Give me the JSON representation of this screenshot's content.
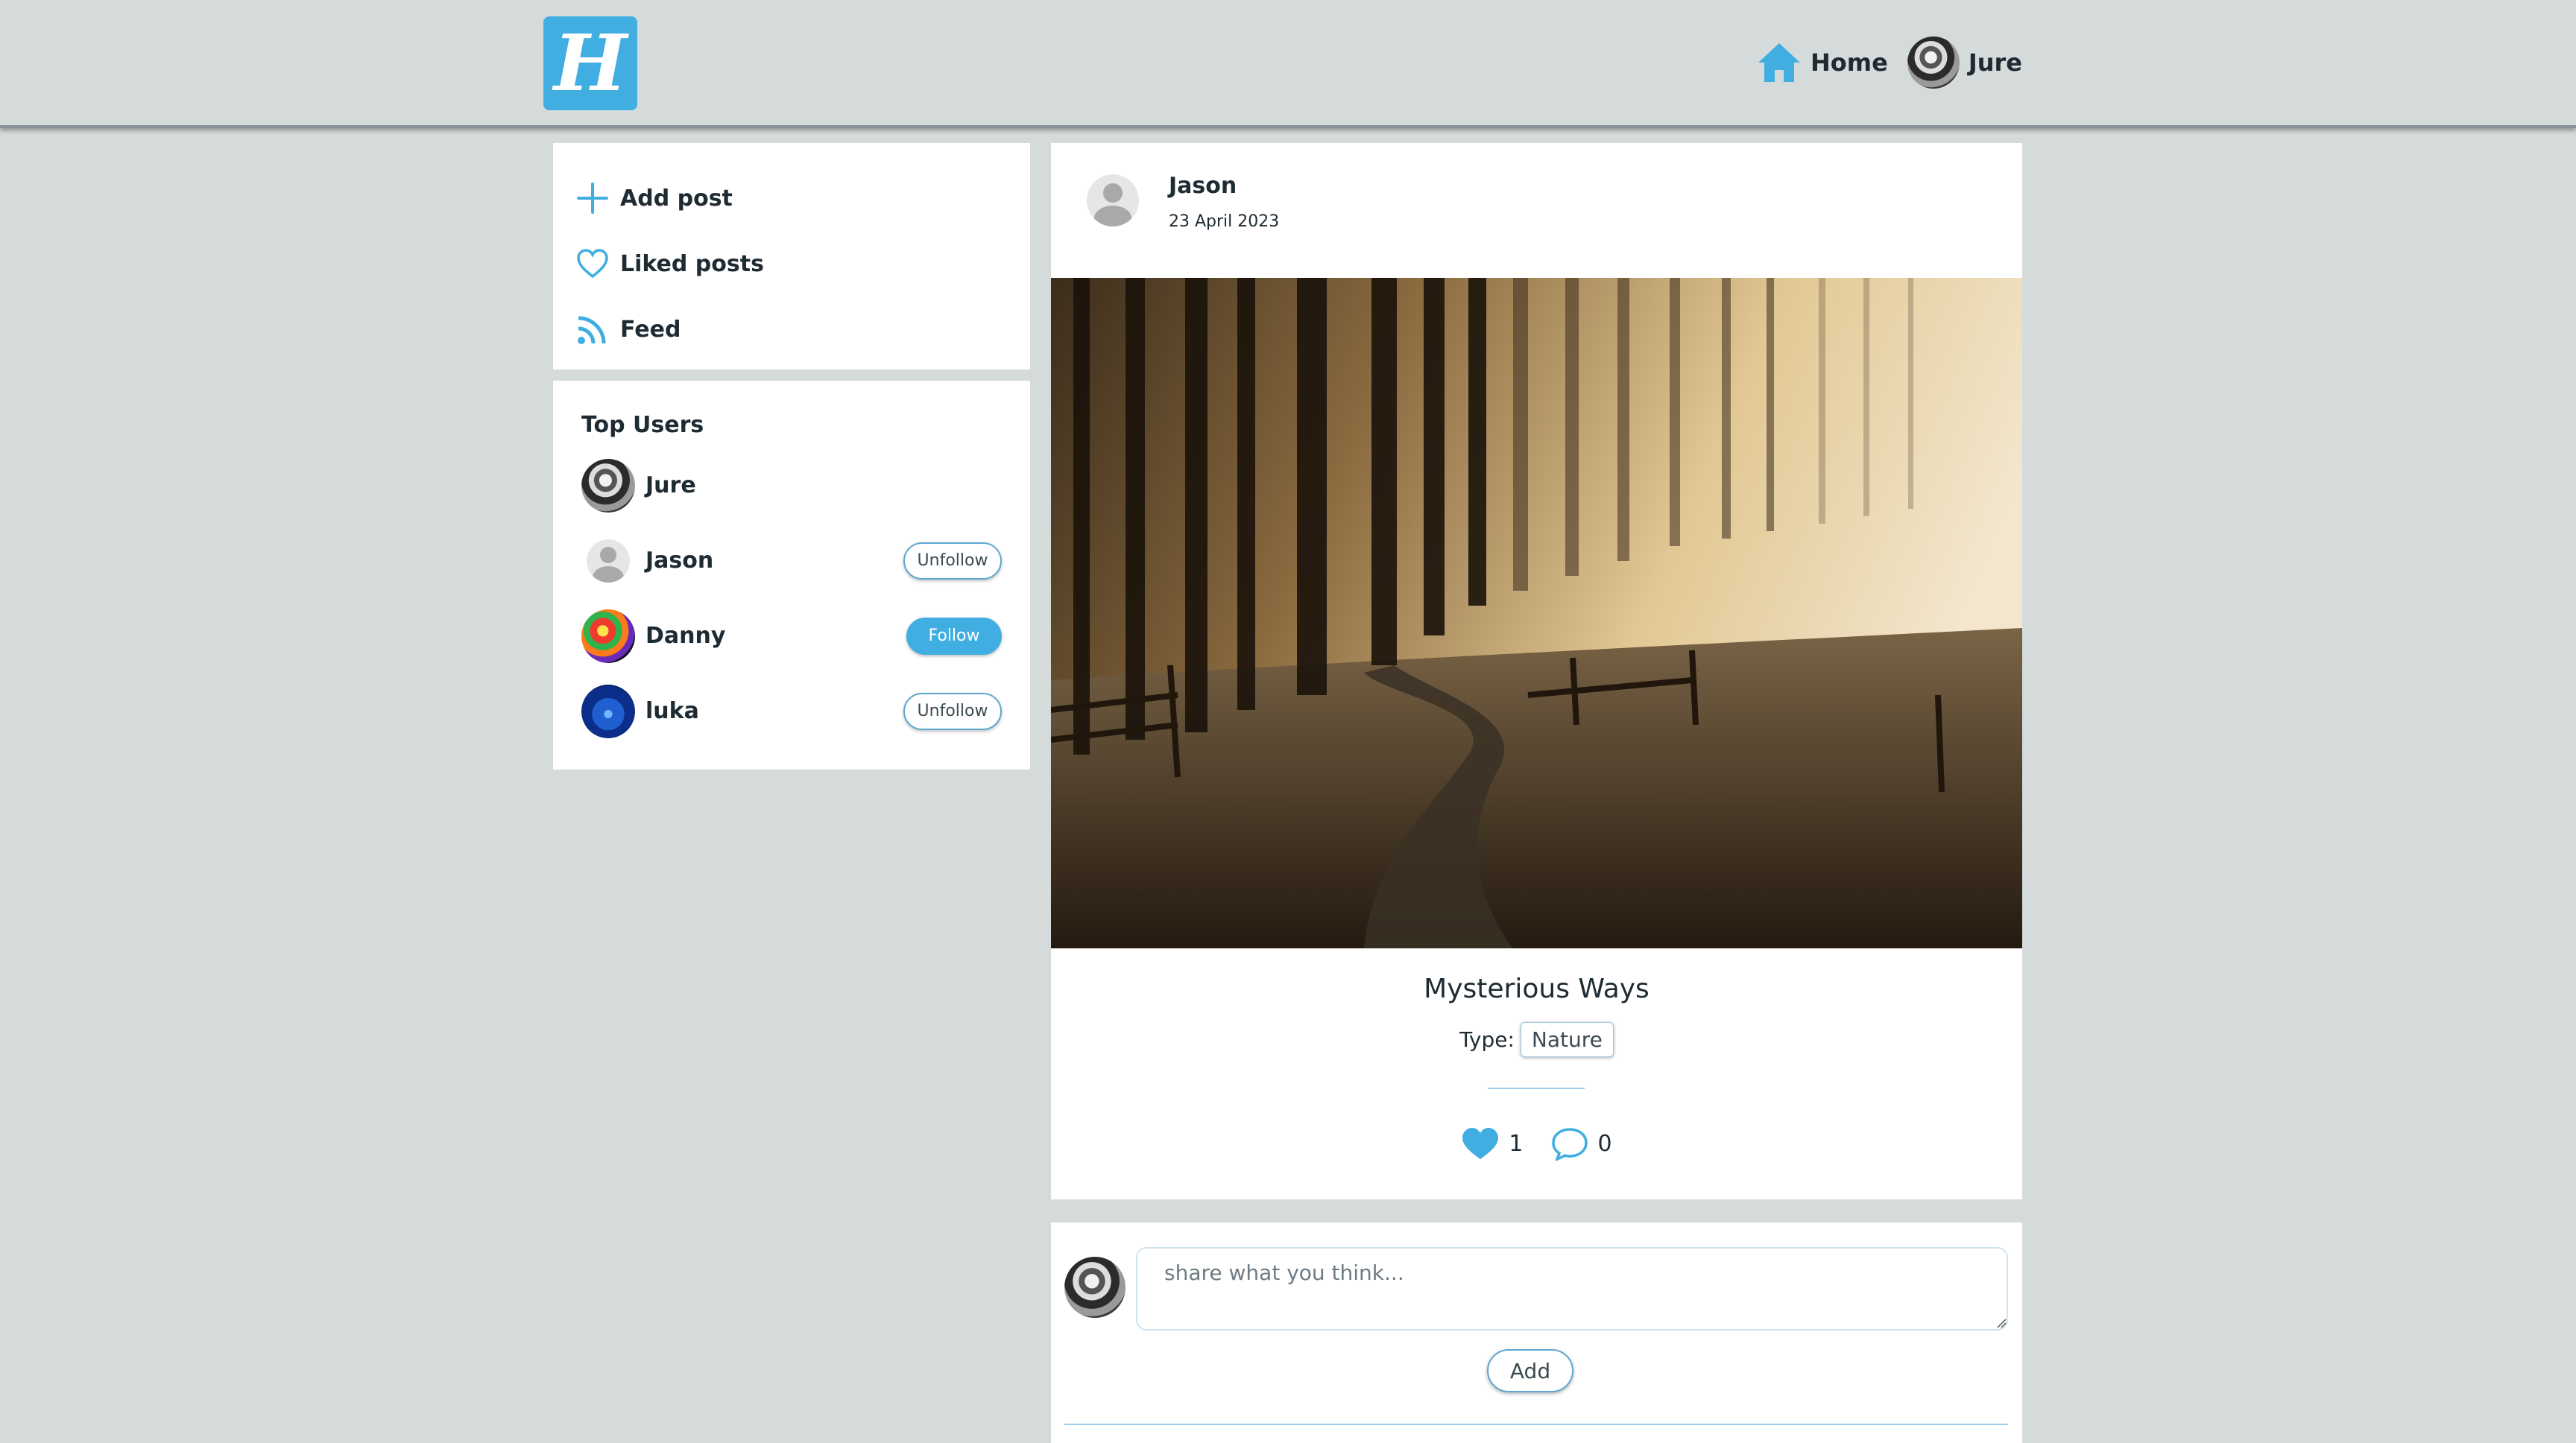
{
  "header": {
    "logo_letter": "H",
    "nav": {
      "home_label": "Home",
      "user_label": "Jure"
    }
  },
  "sidebar": {
    "menu": [
      {
        "label": "Add post",
        "icon": "plus-icon"
      },
      {
        "label": "Liked posts",
        "icon": "heart-outline-icon"
      },
      {
        "label": "Feed",
        "icon": "rss-feed-icon"
      }
    ],
    "top_users": {
      "title": "Top Users",
      "users": [
        {
          "name": "Jure",
          "action": ""
        },
        {
          "name": "Jason",
          "action": "Unfollow"
        },
        {
          "name": "Danny",
          "action": "Follow"
        },
        {
          "name": "luka",
          "action": "Unfollow"
        }
      ]
    }
  },
  "post": {
    "author": "Jason",
    "date": "23 April 2023",
    "title": "Mysterious Ways",
    "type_label": "Type:",
    "type_value": "Nature",
    "likes": "1",
    "comments": "0"
  },
  "comment_form": {
    "placeholder": "share what you think...",
    "add_label": "Add"
  },
  "colors": {
    "accent": "#40aee0",
    "background": "#d5dbdb",
    "text": "#1e2b33"
  }
}
